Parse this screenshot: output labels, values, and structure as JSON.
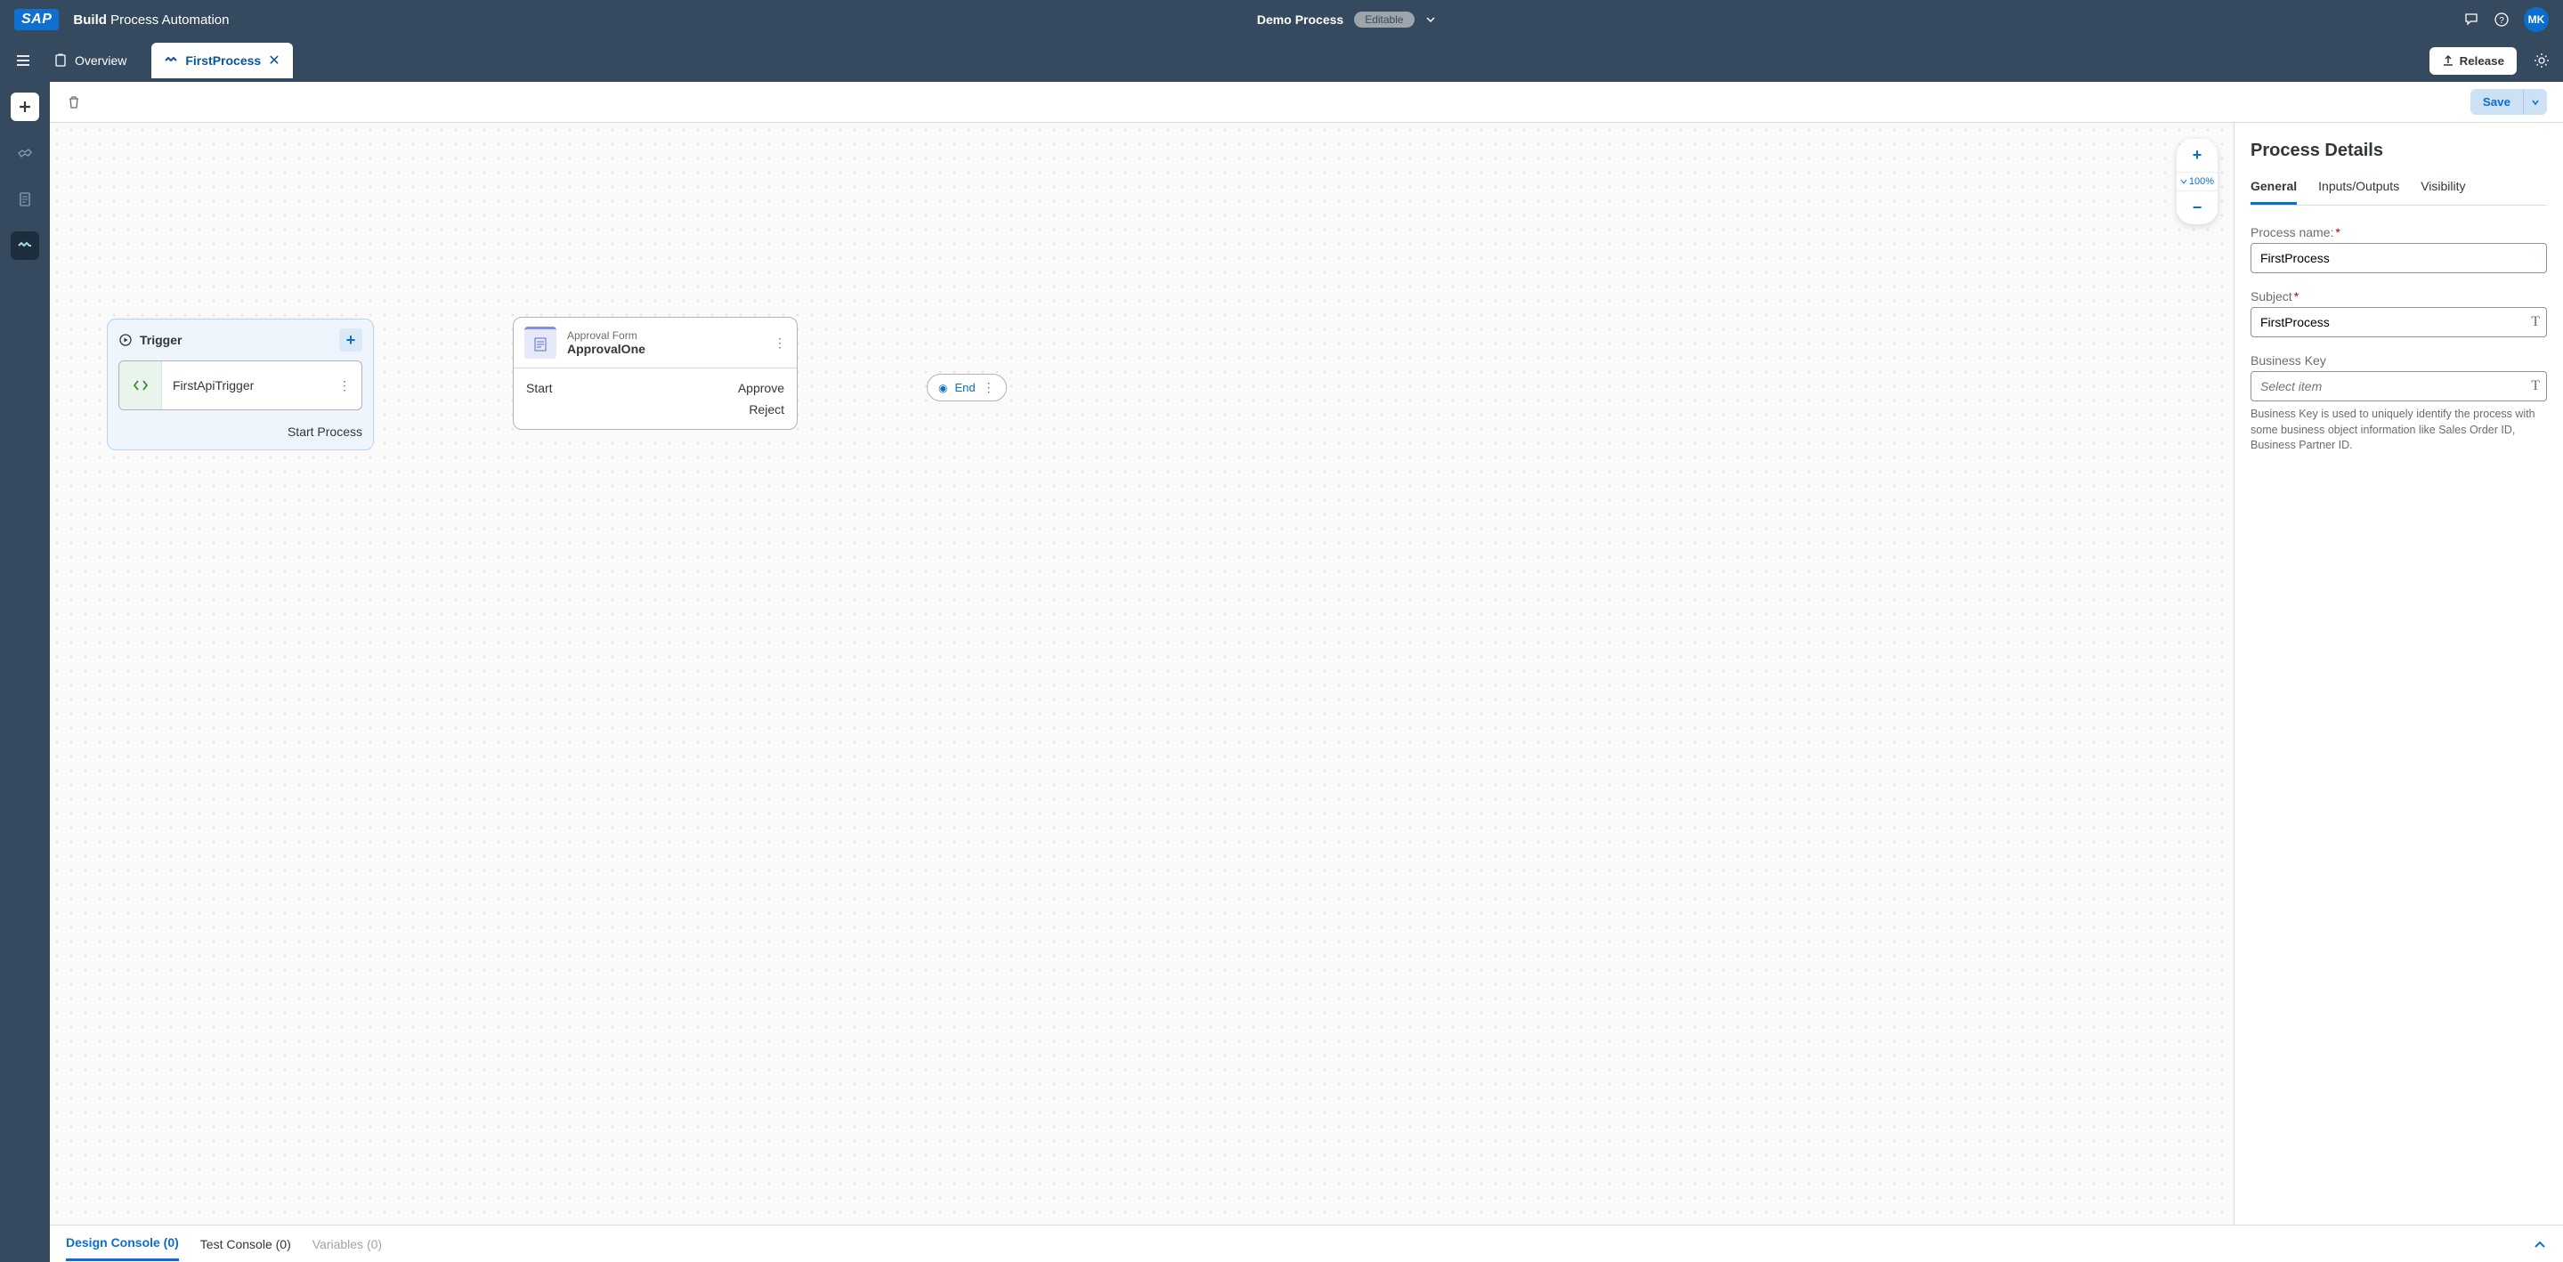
{
  "header": {
    "logo": "SAP",
    "build_bold": "Build",
    "build_rest": "Process Automation",
    "title": "Demo Process",
    "editable_badge": "Editable",
    "avatar": "MK"
  },
  "tabbar": {
    "overview": "Overview",
    "active_tab": "FirstProcess",
    "release": "Release"
  },
  "toolbar": {
    "save": "Save"
  },
  "zoom": {
    "value": "100%"
  },
  "trigger_node": {
    "title": "Trigger",
    "item_name": "FirstApiTrigger",
    "start_process": "Start Process"
  },
  "approval_node": {
    "type_label": "Approval Form",
    "name": "ApprovalOne",
    "start": "Start",
    "approve": "Approve",
    "reject": "Reject"
  },
  "end_node": {
    "label": "End"
  },
  "details": {
    "title": "Process Details",
    "tabs": {
      "general": "General",
      "io": "Inputs/Outputs",
      "visibility": "Visibility"
    },
    "process_name_label": "Process name:",
    "process_name_value": "FirstProcess",
    "subject_label": "Subject",
    "subject_value": "FirstProcess",
    "business_key_label": "Business Key",
    "business_key_placeholder": "Select item",
    "business_key_help": "Business Key is used to uniquely identify the process with some business object information like Sales Order ID, Business Partner ID."
  },
  "bottom_tabs": {
    "design": "Design Console (0)",
    "test": "Test Console (0)",
    "variables": "Variables (0)"
  }
}
